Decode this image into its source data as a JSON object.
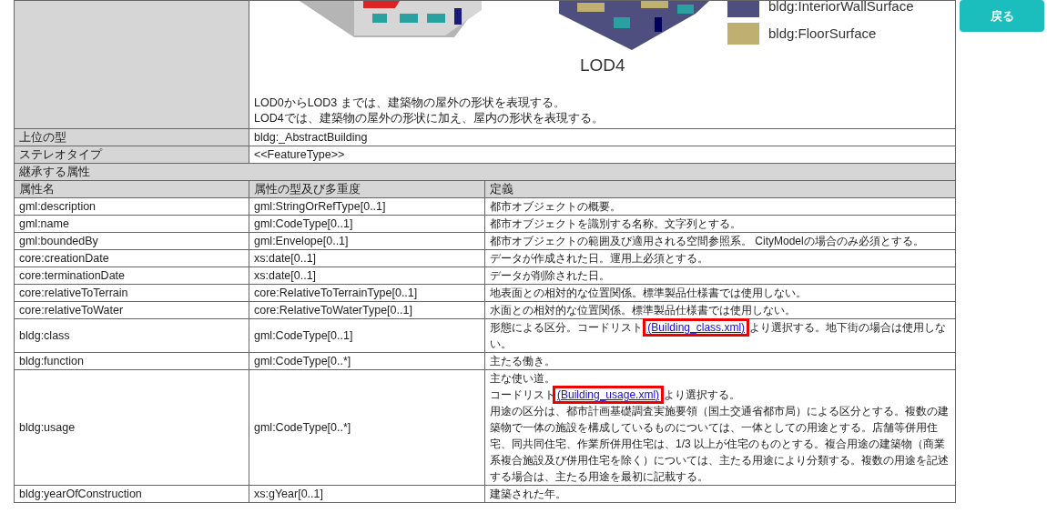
{
  "figure": {
    "legend": [
      {
        "label": "bldg:InteriorWallSurface",
        "color": "#4f4f7f"
      },
      {
        "label": "bldg:FloorSurface",
        "color": "#bfb071"
      }
    ],
    "caption": "LOD4"
  },
  "lod_notes": [
    "LOD0からLOD3 までは、建築物の屋外の形状を表現する。",
    "LOD4では、建築物の屋外の形状に加え、屋内の形状を表現する。"
  ],
  "properties": [
    {
      "label": "上位の型",
      "value": "bldg:_AbstractBuilding"
    },
    {
      "label": "ステレオタイプ",
      "value": "<<FeatureType>>"
    }
  ],
  "section_title": "継承する属性",
  "columns": [
    "属性名",
    "属性の型及び多重度",
    "定義"
  ],
  "rows": [
    {
      "name": "gml:description",
      "type": "gml:StringOrRefType[0..1]",
      "definition": [
        [
          {
            "kind": "text",
            "text": "都市オブジェクトの概要。"
          }
        ]
      ]
    },
    {
      "name": "gml:name",
      "type": "gml:CodeType[0..1]",
      "definition": [
        [
          {
            "kind": "text",
            "text": "都市オブジェクトを識別する名称。文字列とする。"
          }
        ]
      ]
    },
    {
      "name": "gml:boundedBy",
      "type": "gml:Envelope[0..1]",
      "definition": [
        [
          {
            "kind": "text",
            "text": "都市オブジェクトの範囲及び適用される空間参照系。 CityModelの場合のみ必須とする。"
          }
        ]
      ]
    },
    {
      "name": "core:creationDate",
      "type": "xs:date[0..1]",
      "definition": [
        [
          {
            "kind": "text",
            "text": "データが作成された日。運用上必須とする。"
          }
        ]
      ]
    },
    {
      "name": "core:terminationDate",
      "type": "xs:date[0..1]",
      "definition": [
        [
          {
            "kind": "text",
            "text": "データが削除された日。"
          }
        ]
      ]
    },
    {
      "name": "core:relativeToTerrain",
      "type": "core:RelativeToTerrainType[0..1]",
      "definition": [
        [
          {
            "kind": "text",
            "text": "地表面との相対的な位置関係。標準製品仕様書では使用しない。"
          }
        ]
      ]
    },
    {
      "name": "core:relativeToWater",
      "type": "core:RelativeToWaterType[0..1]",
      "definition": [
        [
          {
            "kind": "text",
            "text": "水面との相対的な位置関係。標準製品仕様書では使用しない。"
          }
        ]
      ]
    },
    {
      "name": "bldg:class",
      "type": "gml:CodeType[0..1]",
      "definition": [
        [
          {
            "kind": "text",
            "text": "形態による区分。コードリスト "
          },
          {
            "kind": "link",
            "text": "(Building_class.xml)",
            "highlighted": true
          },
          {
            "kind": "text",
            "text": " より選択する。地下街の場合は使用しない。"
          }
        ]
      ]
    },
    {
      "name": "bldg:function",
      "type": "gml:CodeType[0..*]",
      "definition": [
        [
          {
            "kind": "text",
            "text": "主たる働き。"
          }
        ]
      ]
    },
    {
      "name": "bldg:usage",
      "type": "gml:CodeType[0..*]",
      "definition": [
        [
          {
            "kind": "text",
            "text": "主な使い道。"
          }
        ],
        [
          {
            "kind": "text",
            "text": "コードリスト"
          },
          {
            "kind": "link",
            "text": "(Building_usage.xml)",
            "highlighted": true
          },
          {
            "kind": "text",
            "text": " より選択する。"
          }
        ],
        [
          {
            "kind": "text",
            "text": "用途の区分は、都市計画基礎調査実施要領（国土交通省都市局）による区分とする。複数の建築物で一体の施設を構成しているものについては、一体としての用途とする。店舗等併用住宅、同共同住宅、作業所併用住宅は、1/3 以上が住宅のものとする。複合用途の建築物（商業系複合施設及び併用住宅を除く）については、主たる用途により分類する。複数の用途を記述する場合は、主たる用途を最初に記載する。"
          }
        ]
      ]
    },
    {
      "name": "bldg:yearOfConstruction",
      "type": "xs:gYear[0..1]",
      "definition": [
        [
          {
            "kind": "text",
            "text": "建築された年。"
          }
        ]
      ]
    }
  ],
  "back_button": "戻る"
}
